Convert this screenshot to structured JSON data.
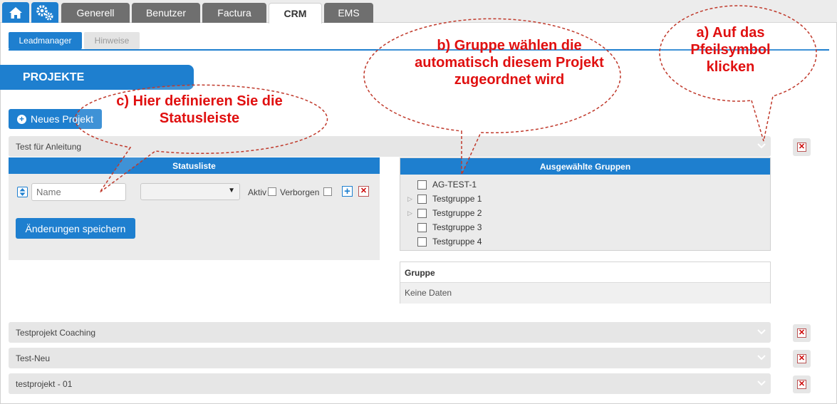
{
  "nav": {
    "tabs": [
      {
        "label": "Generell"
      },
      {
        "label": "Benutzer"
      },
      {
        "label": "Factura"
      },
      {
        "label": "CRM",
        "active": true
      },
      {
        "label": "EMS"
      }
    ]
  },
  "subnav": {
    "tabs": [
      {
        "label": "Leadmanager",
        "active": true
      },
      {
        "label": "Hinweise"
      }
    ]
  },
  "section_title": "PROJEKTE",
  "new_project_label": "Neues Projekt",
  "projects": [
    {
      "name": "Test für Anleitung",
      "expanded": true
    },
    {
      "name": "Testprojekt Coaching"
    },
    {
      "name": "Test-Neu"
    },
    {
      "name": "testprojekt - 01"
    }
  ],
  "statusliste": {
    "title": "Statusliste",
    "name_placeholder": "Name",
    "aktiv_label": "Aktiv",
    "verborgen_label": "Verborgen",
    "save_label": "Änderungen speichern"
  },
  "groups": {
    "title": "Ausgewählte Gruppen",
    "items": [
      {
        "label": "AG-TEST-1",
        "expandable": false
      },
      {
        "label": "Testgruppe 1",
        "expandable": true
      },
      {
        "label": "Testgruppe 2",
        "expandable": true
      },
      {
        "label": "Testgruppe 3",
        "expandable": false
      },
      {
        "label": "Testgruppe 4",
        "expandable": false
      }
    ]
  },
  "gruppe_table": {
    "header": "Gruppe",
    "empty": "Keine Daten"
  },
  "callouts": {
    "a": "a) Auf das Pfeilsymbol klicken",
    "b": "b) Gruppe wählen die automatisch diesem Projekt zugeordnet wird",
    "c": "c) Hier definieren Sie die Statusleiste"
  },
  "colors": {
    "accent": "#1e7fcf",
    "callout": "#e01010",
    "callout_border": "#c0392b"
  }
}
